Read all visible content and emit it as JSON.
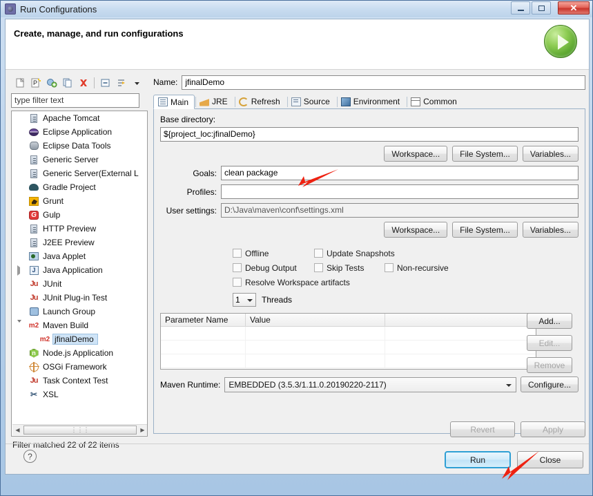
{
  "window": {
    "title": "Run Configurations",
    "title_icon": "run-configurations-icon",
    "minimize_label": "",
    "maximize_label": "",
    "close_label": "✕"
  },
  "header": {
    "title": "Create, manage, and run configurations",
    "icon": "green-run-play-icon"
  },
  "left_panel": {
    "toolbar": [
      {
        "name": "new-configuration-icon",
        "label": ""
      },
      {
        "name": "new-prototype-icon",
        "label": ""
      },
      {
        "name": "new-from-prototype-icon",
        "label": ""
      },
      {
        "name": "duplicate-icon",
        "label": ""
      },
      {
        "name": "delete-icon",
        "label": ""
      },
      {
        "name": "collapse-all-icon",
        "label": ""
      },
      {
        "name": "filter-icon",
        "label": ""
      },
      {
        "name": "view-menu-chevron-icon",
        "label": ""
      }
    ],
    "filter_placeholder": "type filter text",
    "filter_value": "",
    "tree": [
      {
        "label": "Apache Tomcat",
        "icon": "server-icon",
        "indent": 0,
        "twisty": "",
        "selected": false
      },
      {
        "label": "Eclipse Application",
        "icon": "eclipse-icon",
        "indent": 0,
        "twisty": "",
        "selected": false
      },
      {
        "label": "Eclipse Data Tools",
        "icon": "database-icon",
        "indent": 0,
        "twisty": "",
        "selected": false
      },
      {
        "label": "Generic Server",
        "icon": "server-icon",
        "indent": 0,
        "twisty": "",
        "selected": false
      },
      {
        "label": "Generic Server(External L",
        "icon": "server-icon",
        "indent": 0,
        "twisty": "",
        "selected": false
      },
      {
        "label": "Gradle Project",
        "icon": "gradle-icon",
        "indent": 0,
        "twisty": "",
        "selected": false
      },
      {
        "label": "Grunt",
        "icon": "grunt-icon",
        "indent": 0,
        "twisty": "",
        "selected": false
      },
      {
        "label": "Gulp",
        "icon": "gulp-icon",
        "indent": 0,
        "twisty": "",
        "selected": false
      },
      {
        "label": "HTTP Preview",
        "icon": "server-icon",
        "indent": 0,
        "twisty": "",
        "selected": false
      },
      {
        "label": "J2EE Preview",
        "icon": "server-icon",
        "indent": 0,
        "twisty": "",
        "selected": false
      },
      {
        "label": "Java Applet",
        "icon": "java-applet-icon",
        "indent": 0,
        "twisty": "",
        "selected": false
      },
      {
        "label": "Java Application",
        "icon": "java-application-icon",
        "indent": 0,
        "twisty": "collapsed",
        "selected": false
      },
      {
        "label": "JUnit",
        "icon": "junit-icon",
        "indent": 0,
        "twisty": "",
        "selected": false
      },
      {
        "label": "JUnit Plug-in Test",
        "icon": "junit-plugin-icon",
        "indent": 0,
        "twisty": "",
        "selected": false
      },
      {
        "label": "Launch Group",
        "icon": "launch-group-icon",
        "indent": 0,
        "twisty": "",
        "selected": false
      },
      {
        "label": "Maven Build",
        "icon": "maven-icon",
        "indent": 0,
        "twisty": "expanded",
        "selected": false
      },
      {
        "label": "jfinalDemo",
        "icon": "maven-icon",
        "indent": 1,
        "twisty": "",
        "selected": true
      },
      {
        "label": "Node.js Application",
        "icon": "nodejs-icon",
        "indent": 0,
        "twisty": "",
        "selected": false
      },
      {
        "label": "OSGi Framework",
        "icon": "osgi-icon",
        "indent": 0,
        "twisty": "",
        "selected": false
      },
      {
        "label": "Task Context Test",
        "icon": "junit-icon",
        "indent": 0,
        "twisty": "",
        "selected": false
      },
      {
        "label": "XSL",
        "icon": "xsl-icon",
        "indent": 0,
        "twisty": "",
        "selected": false
      }
    ],
    "scrollbar": {
      "left_arrow": "◀",
      "right_arrow": "▶",
      "thumb_grip": "⋮⋮⋮"
    },
    "filter_status": "Filter matched 22 of 22 items",
    "help_label": "?"
  },
  "right_panel": {
    "name_label": "Name:",
    "name_value": "jfinalDemo",
    "tabs": [
      {
        "label": "Main",
        "icon": "main-tab-icon",
        "active": true
      },
      {
        "label": "JRE",
        "icon": "jre-tab-icon",
        "active": false
      },
      {
        "label": "Refresh",
        "icon": "refresh-tab-icon",
        "active": false
      },
      {
        "label": "Source",
        "icon": "source-tab-icon",
        "active": false
      },
      {
        "label": "Environment",
        "icon": "environment-tab-icon",
        "active": false
      },
      {
        "label": "Common",
        "icon": "common-tab-icon",
        "active": false
      }
    ],
    "main_tab": {
      "base_directory_label": "Base directory:",
      "base_directory_value": "${project_loc:jfinalDemo}",
      "browse_buttons_top": [
        "Workspace...",
        "File System...",
        "Variables..."
      ],
      "goals_label": "Goals:",
      "goals_value": "clean package",
      "profiles_label": "Profiles:",
      "profiles_value": "",
      "user_settings_label": "User settings:",
      "user_settings_value": "D:\\Java\\maven\\conf\\settings.xml",
      "browse_buttons_bottom": [
        "Workspace...",
        "File System...",
        "Variables..."
      ],
      "checkboxes": [
        {
          "label": "Offline",
          "checked": false
        },
        {
          "label": "Update Snapshots",
          "checked": false
        },
        {
          "label": "Debug Output",
          "checked": false
        },
        {
          "label": "Skip Tests",
          "checked": false
        },
        {
          "label": "Non-recursive",
          "checked": false
        },
        {
          "label": "Resolve Workspace artifacts",
          "checked": false
        }
      ],
      "threads_value": "1",
      "threads_label": "Threads",
      "parameter_table": {
        "columns": [
          "Parameter Name",
          "Value",
          ""
        ],
        "rows": [],
        "empty_row_count": 3
      },
      "table_buttons": [
        {
          "label": "Add...",
          "disabled": false
        },
        {
          "label": "Edit...",
          "disabled": true
        },
        {
          "label": "Remove",
          "disabled": true
        }
      ],
      "maven_runtime_label": "Maven Runtime:",
      "maven_runtime_value": "EMBEDDED (3.5.3/1.11.0.20190220-2117)",
      "configure_label": "Configure..."
    },
    "revert_label": "Revert",
    "apply_label": "Apply"
  },
  "footer": {
    "run_label": "Run",
    "close_label": "Close"
  },
  "annotations": {
    "arrow_color": "#ee2211",
    "arrow_goals": "points-to-goals-field",
    "arrow_run": "points-to-run-button"
  }
}
